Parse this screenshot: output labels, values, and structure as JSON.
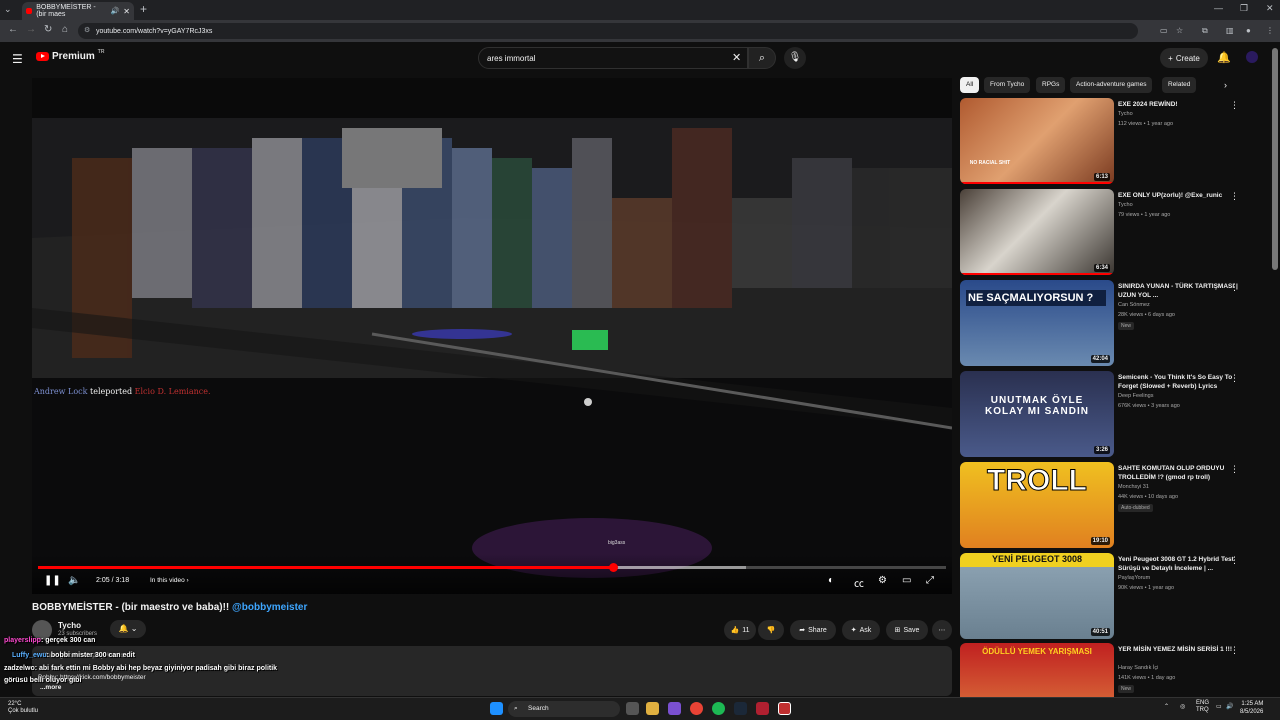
{
  "browser": {
    "tab_title": "BOBBYMEİSTER - (bir maes",
    "url": "youtube.com/watch?v=yGAY7RcJ3xs"
  },
  "header": {
    "brand": "Premium",
    "region": "TR",
    "search_value": "ares immortal",
    "create_label": "Create"
  },
  "player": {
    "killfeed_player1": "Andrew Lock",
    "killfeed_action": "teleported",
    "killfeed_player2": "Elcio D. Lemiance.",
    "time": "2:05 / 3:18",
    "in_video_label": "In this video",
    "progress_fraction": 0.633,
    "buffered_fraction": 0.78,
    "center_tag": "big3ass"
  },
  "video": {
    "title": "BOBBYMEİSTER - (bir maestro ve baba)!!",
    "handle": "@bobbymeister",
    "channel": "Tycho",
    "subscribers": "23 subscribers",
    "like_count": "11",
    "share_label": "Share",
    "ask_label": "Ask",
    "save_label": "Save",
    "desc_line1": "#lua #gmod #roleplay #runic",
    "desc_line2": "Bobby: https://kick.com/bobbymeister",
    "desc_more": "...more"
  },
  "overlay_chat": [
    {
      "user": "playerslipp",
      "text": ": gerçek 300 can",
      "user_color": "#ff4ad0"
    },
    {
      "user": "Luffy_ewu",
      "text": ": bobbi mister 300 can edit",
      "user_color": "#5ab0ff"
    },
    {
      "user": "zadzelwo",
      "text": ": abi fark ettin mi Bobby abi hep beyaz giyiniyor padisah gibi biraz politik",
      "user_color": "#ffffff"
    },
    {
      "user": "",
      "text": "görüsü belli oluyor gibi",
      "user_color": "#ffffff"
    }
  ],
  "chips": [
    "All",
    "From Tycho",
    "RPGs",
    "Action-adventure games",
    "Related"
  ],
  "recommendations": [
    {
      "title": "EXE 2024 REWİND!",
      "channel": "Tycho",
      "meta": "112 views • 1 year ago",
      "duration": "6:13",
      "thumb_text": "NO RACIAL SHIT",
      "badge": ""
    },
    {
      "title": "EXE ONLY UP(zorlu)! @Exe_runic",
      "channel": "Tycho",
      "meta": "79 views • 1 year ago",
      "duration": "6:34",
      "thumb_text": "",
      "badge": ""
    },
    {
      "title": "SINIRDA YUNAN - TÜRK TARTIŞMASI | UZUN YOL ...",
      "channel": "Can Sönmez",
      "meta": "28K views • 6 days ago",
      "duration": "42:04",
      "thumb_text": "NE SAÇMALIYORSUN ?",
      "badge": "New"
    },
    {
      "title": "Semicenk - You Think It's So Easy To Forget (Slowed + Reverb) Lyrics",
      "channel": "Deep Feelings",
      "meta": "676K views • 3 years ago",
      "duration": "3:26",
      "thumb_text": "UNUTMAK ÖYLE KOLAY MI SANDIN",
      "badge": ""
    },
    {
      "title": "SAHTE KOMUTAN OLUP ORDUYU TROLLEDİM !? (gmod rp troll)",
      "channel": "Monchsyi 31",
      "meta": "44K views • 10 days ago",
      "duration": "19:10",
      "thumb_text": "TROLL",
      "badge": "Auto-dubbed"
    },
    {
      "title": "Yeni Peugeot 3008 GT 1.2 Hybrid Test Sürüşü ve Detaylı İnceleme | ...",
      "channel": "PaylaşYorum",
      "meta": "90K views • 1 year ago",
      "duration": "40:51",
      "thumb_text": "YENİ PEUGEOT 3008",
      "badge": ""
    },
    {
      "title": "YER MİSİN YEMEZ MİSİN SERİSİ 1 !!!",
      "channel": "Haray Sandık İçi",
      "meta": "141K views • 1 day ago",
      "duration": "",
      "thumb_text": "ÖDÜLLÜ YEMEK YARIŞMASI",
      "badge": "New"
    }
  ],
  "taskbar": {
    "temp": "22°C",
    "weather": "Çok bulutlu",
    "search_label": "Search",
    "lang1": "ENG",
    "lang2": "TRQ",
    "time": "1:25 AM",
    "date": "8/5/2026"
  }
}
